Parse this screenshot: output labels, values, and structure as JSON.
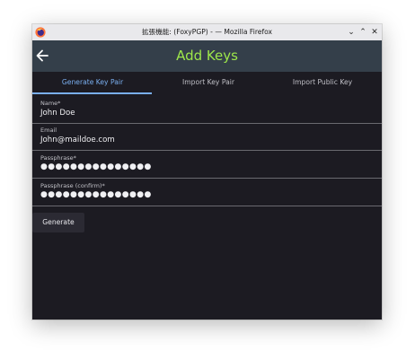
{
  "titlebar": {
    "title": "拡張機能: (FoxyPGP) - — Mozilla Firefox",
    "logo_icon": "firefox-logo",
    "buttons": {
      "minimize": "⌄",
      "maximize": "⌃",
      "close": "✕"
    }
  },
  "header": {
    "back_icon": "arrow-left-icon",
    "title": "Add Keys",
    "title_color": "#9ee84a",
    "background": "#343f4a"
  },
  "tabs": [
    {
      "label": "Generate Key Pair",
      "active": true
    },
    {
      "label": "Import Key Pair",
      "active": false
    },
    {
      "label": "Import Public Key",
      "active": false
    }
  ],
  "accent": "#7aaff0",
  "form": {
    "name": {
      "label": "Name*",
      "value": "John Doe"
    },
    "email": {
      "label": "Email",
      "value": "John@maildoe.com"
    },
    "passphrase": {
      "label": "Passphrase*",
      "value": "●●●●●●●●●●●●●●●"
    },
    "passphrase_confirm": {
      "label": "Passphrase (confirm)*",
      "value": "●●●●●●●●●●●●●●●"
    }
  },
  "generate_button": {
    "label": "Generate"
  }
}
